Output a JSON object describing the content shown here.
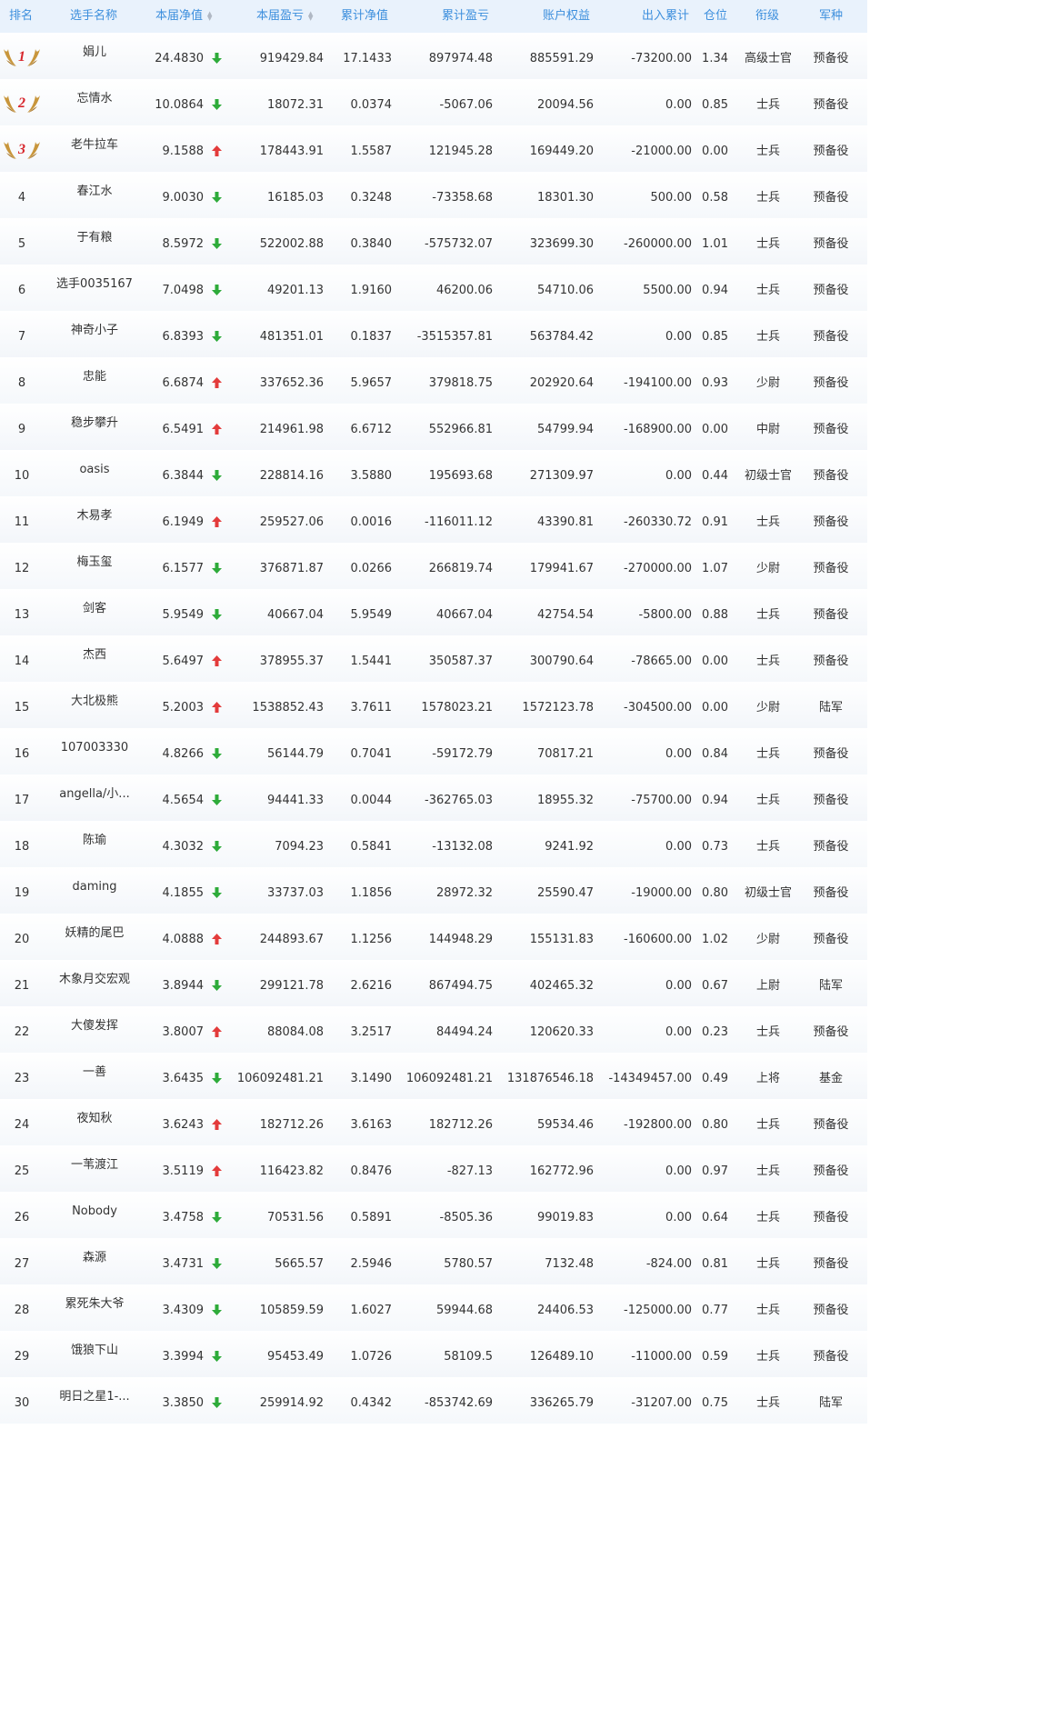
{
  "columns": {
    "rank": "排名",
    "name": "选手名称",
    "nav": "本届净值",
    "profit": "本届盈亏",
    "cum_nav": "累计净值",
    "cum_profit": "累计盈亏",
    "equity": "账户权益",
    "flow": "出入累计",
    "position": "仓位",
    "title": "衔级",
    "branch": "军种"
  },
  "colors": {
    "header_bg": "#e9f2fc",
    "header_text": "#3d8fdd",
    "up": "#e33b3b",
    "down": "#2eab3a",
    "medal_gold": "#c8963c",
    "medal_red": "#d7262c"
  },
  "icons": {
    "up": "arrow-up-icon",
    "down": "arrow-down-icon",
    "medal": "laurel-medal-icon",
    "sort": "sort-caret-icon"
  },
  "rows": [
    {
      "rank": "1",
      "name": "娟儿",
      "nav": "24.4830",
      "trend": "down",
      "profit": "919429.84",
      "cum_nav": "17.1433",
      "cum_profit": "897974.48",
      "equity": "885591.29",
      "flow": "-73200.00",
      "position": "1.34",
      "title": "高级士官",
      "branch": "预备役"
    },
    {
      "rank": "2",
      "name": "忘情水",
      "nav": "10.0864",
      "trend": "down",
      "profit": "18072.31",
      "cum_nav": "0.0374",
      "cum_profit": "-5067.06",
      "equity": "20094.56",
      "flow": "0.00",
      "position": "0.85",
      "title": "士兵",
      "branch": "预备役"
    },
    {
      "rank": "3",
      "name": "老牛拉车",
      "nav": "9.1588",
      "trend": "up",
      "profit": "178443.91",
      "cum_nav": "1.5587",
      "cum_profit": "121945.28",
      "equity": "169449.20",
      "flow": "-21000.00",
      "position": "0.00",
      "title": "士兵",
      "branch": "预备役"
    },
    {
      "rank": "4",
      "name": "春江水",
      "nav": "9.0030",
      "trend": "down",
      "profit": "16185.03",
      "cum_nav": "0.3248",
      "cum_profit": "-73358.68",
      "equity": "18301.30",
      "flow": "500.00",
      "position": "0.58",
      "title": "士兵",
      "branch": "预备役"
    },
    {
      "rank": "5",
      "name": "于有粮",
      "nav": "8.5972",
      "trend": "down",
      "profit": "522002.88",
      "cum_nav": "0.3840",
      "cum_profit": "-575732.07",
      "equity": "323699.30",
      "flow": "-260000.00",
      "position": "1.01",
      "title": "士兵",
      "branch": "预备役"
    },
    {
      "rank": "6",
      "name": "选手0035167",
      "nav": "7.0498",
      "trend": "down",
      "profit": "49201.13",
      "cum_nav": "1.9160",
      "cum_profit": "46200.06",
      "equity": "54710.06",
      "flow": "5500.00",
      "position": "0.94",
      "title": "士兵",
      "branch": "预备役"
    },
    {
      "rank": "7",
      "name": "神奇小子",
      "nav": "6.8393",
      "trend": "down",
      "profit": "481351.01",
      "cum_nav": "0.1837",
      "cum_profit": "-3515357.81",
      "equity": "563784.42",
      "flow": "0.00",
      "position": "0.85",
      "title": "士兵",
      "branch": "预备役"
    },
    {
      "rank": "8",
      "name": "忠能",
      "nav": "6.6874",
      "trend": "up",
      "profit": "337652.36",
      "cum_nav": "5.9657",
      "cum_profit": "379818.75",
      "equity": "202920.64",
      "flow": "-194100.00",
      "position": "0.93",
      "title": "少尉",
      "branch": "预备役"
    },
    {
      "rank": "9",
      "name": "稳步攀升",
      "nav": "6.5491",
      "trend": "up",
      "profit": "214961.98",
      "cum_nav": "6.6712",
      "cum_profit": "552966.81",
      "equity": "54799.94",
      "flow": "-168900.00",
      "position": "0.00",
      "title": "中尉",
      "branch": "预备役"
    },
    {
      "rank": "10",
      "name": "oasis",
      "nav": "6.3844",
      "trend": "down",
      "profit": "228814.16",
      "cum_nav": "3.5880",
      "cum_profit": "195693.68",
      "equity": "271309.97",
      "flow": "0.00",
      "position": "0.44",
      "title": "初级士官",
      "branch": "预备役"
    },
    {
      "rank": "11",
      "name": "木易孝",
      "nav": "6.1949",
      "trend": "up",
      "profit": "259527.06",
      "cum_nav": "0.0016",
      "cum_profit": "-116011.12",
      "equity": "43390.81",
      "flow": "-260330.72",
      "position": "0.91",
      "title": "士兵",
      "branch": "预备役"
    },
    {
      "rank": "12",
      "name": "梅玉玺",
      "nav": "6.1577",
      "trend": "down",
      "profit": "376871.87",
      "cum_nav": "0.0266",
      "cum_profit": "266819.74",
      "equity": "179941.67",
      "flow": "-270000.00",
      "position": "1.07",
      "title": "少尉",
      "branch": "预备役"
    },
    {
      "rank": "13",
      "name": "剑客",
      "nav": "5.9549",
      "trend": "down",
      "profit": "40667.04",
      "cum_nav": "5.9549",
      "cum_profit": "40667.04",
      "equity": "42754.54",
      "flow": "-5800.00",
      "position": "0.88",
      "title": "士兵",
      "branch": "预备役"
    },
    {
      "rank": "14",
      "name": "杰西",
      "nav": "5.6497",
      "trend": "up",
      "profit": "378955.37",
      "cum_nav": "1.5441",
      "cum_profit": "350587.37",
      "equity": "300790.64",
      "flow": "-78665.00",
      "position": "0.00",
      "title": "士兵",
      "branch": "预备役"
    },
    {
      "rank": "15",
      "name": "大北极熊",
      "nav": "5.2003",
      "trend": "up",
      "profit": "1538852.43",
      "cum_nav": "3.7611",
      "cum_profit": "1578023.21",
      "equity": "1572123.78",
      "flow": "-304500.00",
      "position": "0.00",
      "title": "少尉",
      "branch": "陆军"
    },
    {
      "rank": "16",
      "name": "107003330",
      "nav": "4.8266",
      "trend": "down",
      "profit": "56144.79",
      "cum_nav": "0.7041",
      "cum_profit": "-59172.79",
      "equity": "70817.21",
      "flow": "0.00",
      "position": "0.84",
      "title": "士兵",
      "branch": "预备役"
    },
    {
      "rank": "17",
      "name": "angella/小...",
      "nav": "4.5654",
      "trend": "down",
      "profit": "94441.33",
      "cum_nav": "0.0044",
      "cum_profit": "-362765.03",
      "equity": "18955.32",
      "flow": "-75700.00",
      "position": "0.94",
      "title": "士兵",
      "branch": "预备役"
    },
    {
      "rank": "18",
      "name": "陈瑜",
      "nav": "4.3032",
      "trend": "down",
      "profit": "7094.23",
      "cum_nav": "0.5841",
      "cum_profit": "-13132.08",
      "equity": "9241.92",
      "flow": "0.00",
      "position": "0.73",
      "title": "士兵",
      "branch": "预备役"
    },
    {
      "rank": "19",
      "name": "daming",
      "nav": "4.1855",
      "trend": "down",
      "profit": "33737.03",
      "cum_nav": "1.1856",
      "cum_profit": "28972.32",
      "equity": "25590.47",
      "flow": "-19000.00",
      "position": "0.80",
      "title": "初级士官",
      "branch": "预备役"
    },
    {
      "rank": "20",
      "name": "妖精的尾巴",
      "nav": "4.0888",
      "trend": "up",
      "profit": "244893.67",
      "cum_nav": "1.1256",
      "cum_profit": "144948.29",
      "equity": "155131.83",
      "flow": "-160600.00",
      "position": "1.02",
      "title": "少尉",
      "branch": "预备役"
    },
    {
      "rank": "21",
      "name": "木象月交宏观",
      "nav": "3.8944",
      "trend": "down",
      "profit": "299121.78",
      "cum_nav": "2.6216",
      "cum_profit": "867494.75",
      "equity": "402465.32",
      "flow": "0.00",
      "position": "0.67",
      "title": "上尉",
      "branch": "陆军"
    },
    {
      "rank": "22",
      "name": "大傻发挥",
      "nav": "3.8007",
      "trend": "up",
      "profit": "88084.08",
      "cum_nav": "3.2517",
      "cum_profit": "84494.24",
      "equity": "120620.33",
      "flow": "0.00",
      "position": "0.23",
      "title": "士兵",
      "branch": "预备役"
    },
    {
      "rank": "23",
      "name": "一善",
      "nav": "3.6435",
      "trend": "down",
      "profit": "106092481.21",
      "cum_nav": "3.1490",
      "cum_profit": "106092481.21",
      "equity": "131876546.18",
      "flow": "-14349457.00",
      "position": "0.49",
      "title": "上将",
      "branch": "基金"
    },
    {
      "rank": "24",
      "name": "夜知秋",
      "nav": "3.6243",
      "trend": "up",
      "profit": "182712.26",
      "cum_nav": "3.6163",
      "cum_profit": "182712.26",
      "equity": "59534.46",
      "flow": "-192800.00",
      "position": "0.80",
      "title": "士兵",
      "branch": "预备役"
    },
    {
      "rank": "25",
      "name": "一苇渡江",
      "nav": "3.5119",
      "trend": "up",
      "profit": "116423.82",
      "cum_nav": "0.8476",
      "cum_profit": "-827.13",
      "equity": "162772.96",
      "flow": "0.00",
      "position": "0.97",
      "title": "士兵",
      "branch": "预备役"
    },
    {
      "rank": "26",
      "name": "Nobody",
      "nav": "3.4758",
      "trend": "down",
      "profit": "70531.56",
      "cum_nav": "0.5891",
      "cum_profit": "-8505.36",
      "equity": "99019.83",
      "flow": "0.00",
      "position": "0.64",
      "title": "士兵",
      "branch": "预备役"
    },
    {
      "rank": "27",
      "name": "森源",
      "nav": "3.4731",
      "trend": "down",
      "profit": "5665.57",
      "cum_nav": "2.5946",
      "cum_profit": "5780.57",
      "equity": "7132.48",
      "flow": "-824.00",
      "position": "0.81",
      "title": "士兵",
      "branch": "预备役"
    },
    {
      "rank": "28",
      "name": "累死朱大爷",
      "nav": "3.4309",
      "trend": "down",
      "profit": "105859.59",
      "cum_nav": "1.6027",
      "cum_profit": "59944.68",
      "equity": "24406.53",
      "flow": "-125000.00",
      "position": "0.77",
      "title": "士兵",
      "branch": "预备役"
    },
    {
      "rank": "29",
      "name": "饿狼下山",
      "nav": "3.3994",
      "trend": "down",
      "profit": "95453.49",
      "cum_nav": "1.0726",
      "cum_profit": "58109.5",
      "equity": "126489.10",
      "flow": "-11000.00",
      "position": "0.59",
      "title": "士兵",
      "branch": "预备役"
    },
    {
      "rank": "30",
      "name": "明日之星1-...",
      "nav": "3.3850",
      "trend": "down",
      "profit": "259914.92",
      "cum_nav": "0.4342",
      "cum_profit": "-853742.69",
      "equity": "336265.79",
      "flow": "-31207.00",
      "position": "0.75",
      "title": "士兵",
      "branch": "陆军"
    }
  ]
}
